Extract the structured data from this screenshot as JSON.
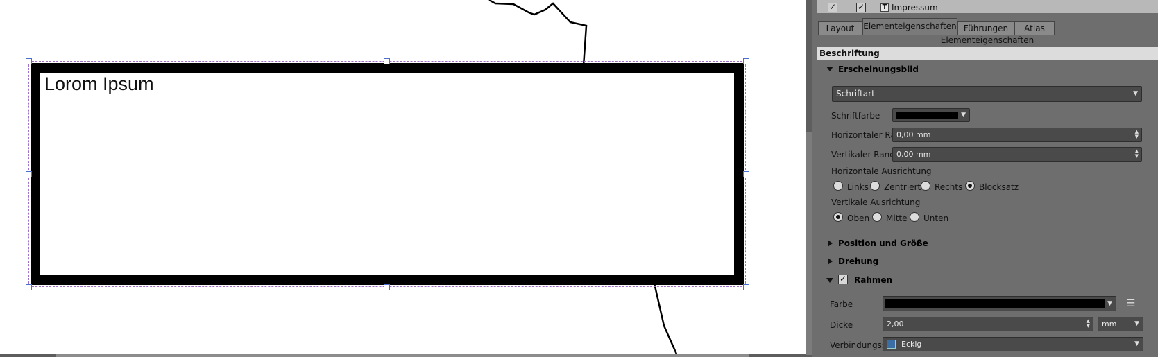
{
  "canvas": {
    "label_text": "Lorom Ipsum"
  },
  "panel": {
    "layer_item": {
      "name": "Impressum"
    },
    "tabs": [
      {
        "label": "Layout",
        "active": false
      },
      {
        "label": "Elementeigenschaften",
        "active": true
      },
      {
        "label": "Führungen",
        "active": false
      },
      {
        "label": "Atlas",
        "active": false
      }
    ],
    "title": "Elementeigenschaften",
    "section": "Beschriftung",
    "appearance": {
      "header": "Erscheinungsbild",
      "font_button": "Schriftart",
      "font_color_label": "Schriftfarbe",
      "font_color": "#000000",
      "h_margin_label": "Horizontaler Rand",
      "h_margin_value": "0,00 mm",
      "v_margin_label": "Vertikaler Rand",
      "v_margin_value": "0,00 mm",
      "h_align_label": "Horizontale Ausrichtung",
      "h_align_options": [
        "Links",
        "Zentriert",
        "Rechts",
        "Blocksatz"
      ],
      "h_align_selected": "Blocksatz",
      "v_align_label": "Vertikale Ausrichtung",
      "v_align_options": [
        "Oben",
        "Mitte",
        "Unten"
      ],
      "v_align_selected": "Oben"
    },
    "position_header": "Position und Größe",
    "rotation_header": "Drehung",
    "frame": {
      "header": "Rahmen",
      "checked": true,
      "color_label": "Farbe",
      "color": "#000000",
      "thickness_label": "Dicke",
      "thickness_value": "2,00",
      "unit": "mm",
      "join_label": "Verbindungsstil",
      "join_value": "Eckig"
    }
  }
}
